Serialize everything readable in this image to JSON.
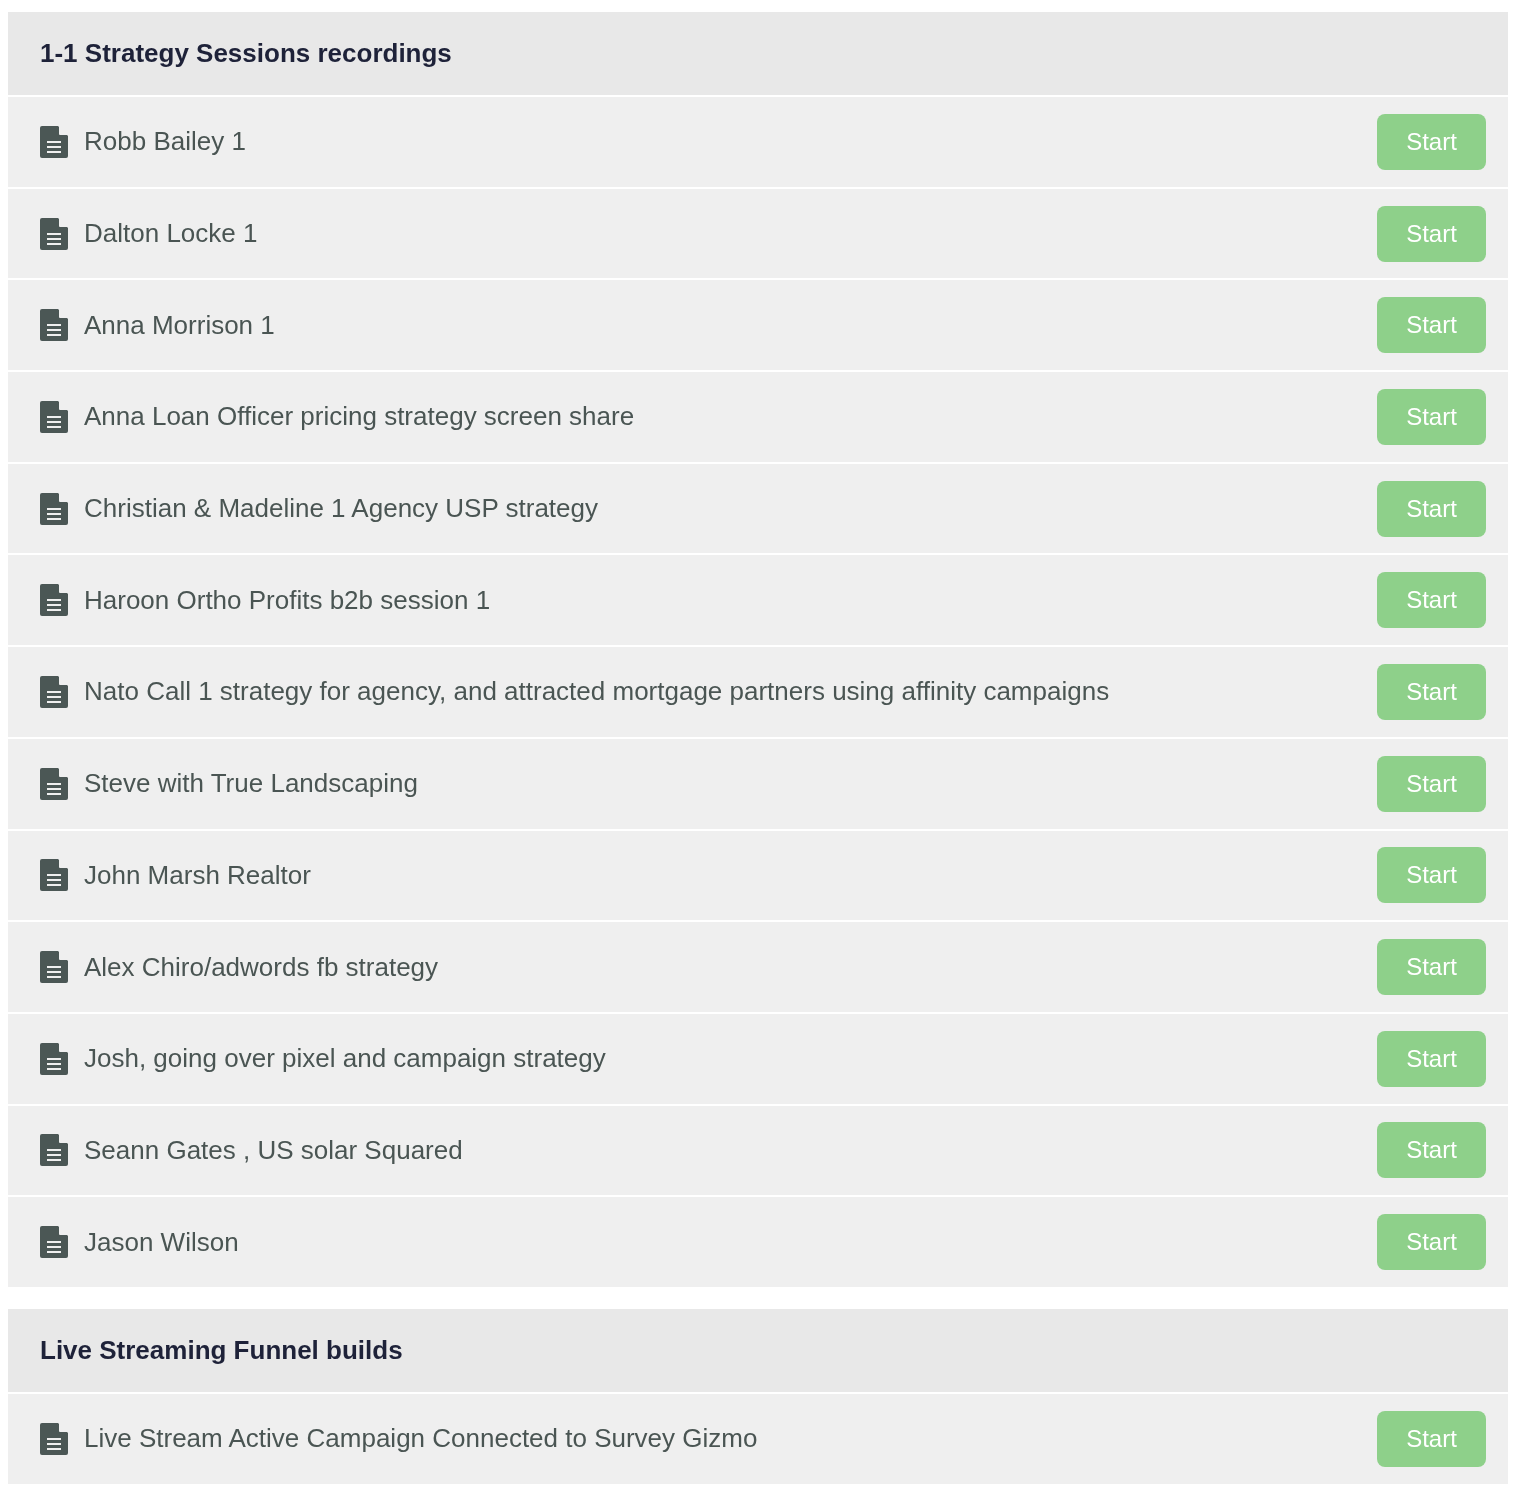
{
  "sections": [
    {
      "title": "1-1 Strategy Sessions recordings",
      "lessons": [
        {
          "title": "Robb Bailey 1",
          "button": "Start"
        },
        {
          "title": "Dalton Locke 1",
          "button": "Start"
        },
        {
          "title": "Anna Morrison 1",
          "button": "Start"
        },
        {
          "title": "Anna Loan Officer pricing strategy screen share",
          "button": "Start"
        },
        {
          "title": "Christian & Madeline 1 Agency USP strategy",
          "button": "Start"
        },
        {
          "title": "Haroon Ortho Profits b2b session 1",
          "button": "Start"
        },
        {
          "title": "Nato Call 1 strategy for agency, and attracted mortgage partners using affinity campaigns",
          "button": "Start"
        },
        {
          "title": "Steve with True Landscaping",
          "button": "Start"
        },
        {
          "title": "John Marsh Realtor",
          "button": "Start"
        },
        {
          "title": "Alex Chiro/adwords fb strategy",
          "button": "Start"
        },
        {
          "title": "Josh, going over pixel and campaign strategy",
          "button": "Start"
        },
        {
          "title": "Seann Gates , US solar Squared",
          "button": "Start"
        },
        {
          "title": "Jason Wilson",
          "button": "Start"
        }
      ]
    },
    {
      "title": "Live Streaming Funnel builds",
      "lessons": [
        {
          "title": "Live Stream Active Campaign Connected to Survey Gizmo",
          "button": "Start"
        }
      ]
    }
  ]
}
